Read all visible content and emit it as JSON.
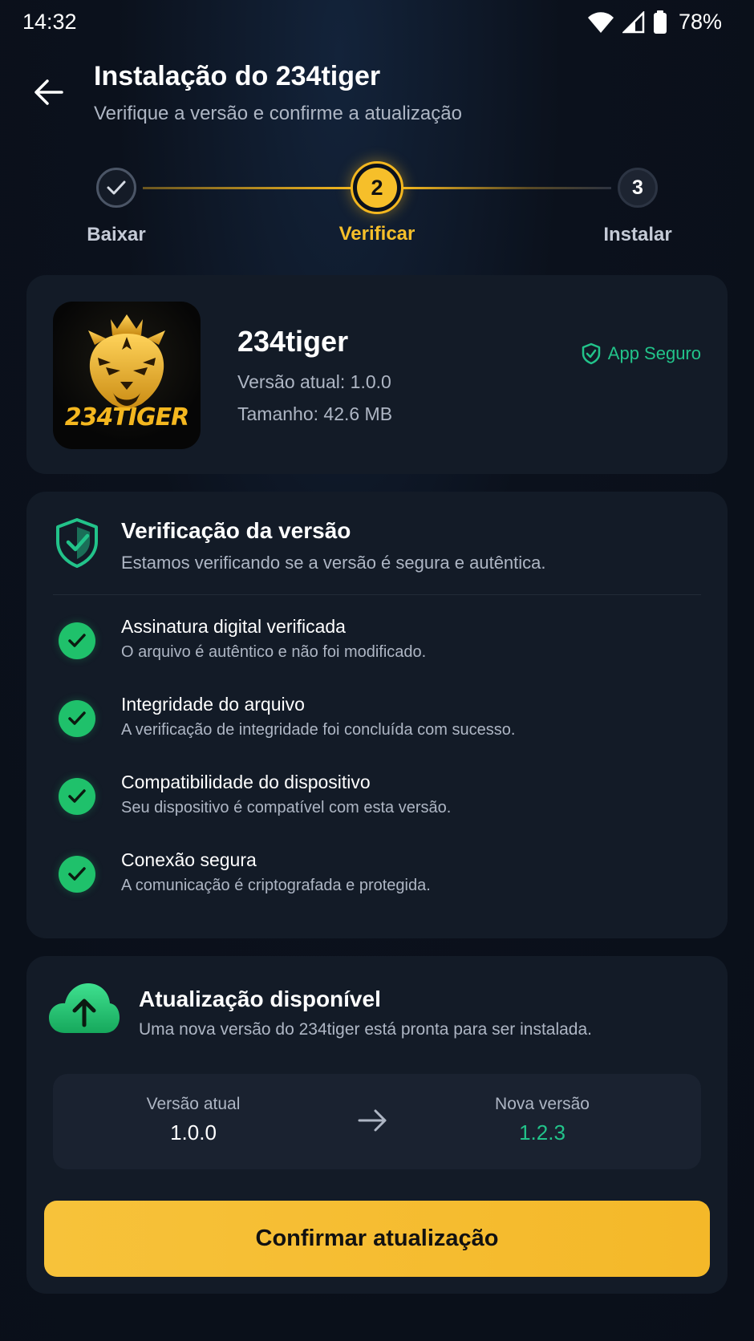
{
  "status_bar": {
    "time": "14:32",
    "battery": "78%"
  },
  "header": {
    "title": "Instalação do 234tiger",
    "subtitle": "Verifique a versão e confirme a atualização"
  },
  "stepper": {
    "steps": [
      {
        "label": "Baixar",
        "state": "done"
      },
      {
        "label": "Verificar",
        "number": "2",
        "state": "active"
      },
      {
        "label": "Instalar",
        "number": "3",
        "state": "pending"
      }
    ]
  },
  "app": {
    "logo_text": "234TIGER",
    "name": "234tiger",
    "version": "Versão atual: 1.0.0",
    "size": "Tamanho: 42.6 MB",
    "badge": "App Seguro"
  },
  "verification": {
    "title": "Verificação da versão",
    "subtitle": "Estamos verificando se a versão é segura e autêntica.",
    "items": [
      {
        "title": "Assinatura digital verificada",
        "desc": "O arquivo é autêntico e não foi modificado."
      },
      {
        "title": "Integridade do arquivo",
        "desc": "A verificação de integridade foi concluída com sucesso."
      },
      {
        "title": "Compatibilidade do dispositivo",
        "desc": "Seu dispositivo é compatível com esta versão."
      },
      {
        "title": "Conexão segura",
        "desc": "A comunicação é criptografada e protegida."
      }
    ]
  },
  "update": {
    "title": "Atualização disponível",
    "subtitle": "Uma nova versão do 234tiger está pronta para ser instalada.",
    "current_label": "Versão atual",
    "current_value": "1.0.0",
    "new_label": "Nova versão",
    "new_value": "1.2.3",
    "confirm_label": "Confirmar atualização"
  },
  "colors": {
    "accent": "#f6bf2a",
    "success": "#22c38a",
    "background": "#0b111c",
    "card": "#131b27"
  },
  "icons": [
    "back-arrow-icon",
    "wifi-icon",
    "signal-icon",
    "battery-icon",
    "check-icon",
    "shield-check-icon",
    "cloud-upload-icon",
    "arrow-right-icon",
    "tiger-logo"
  ]
}
